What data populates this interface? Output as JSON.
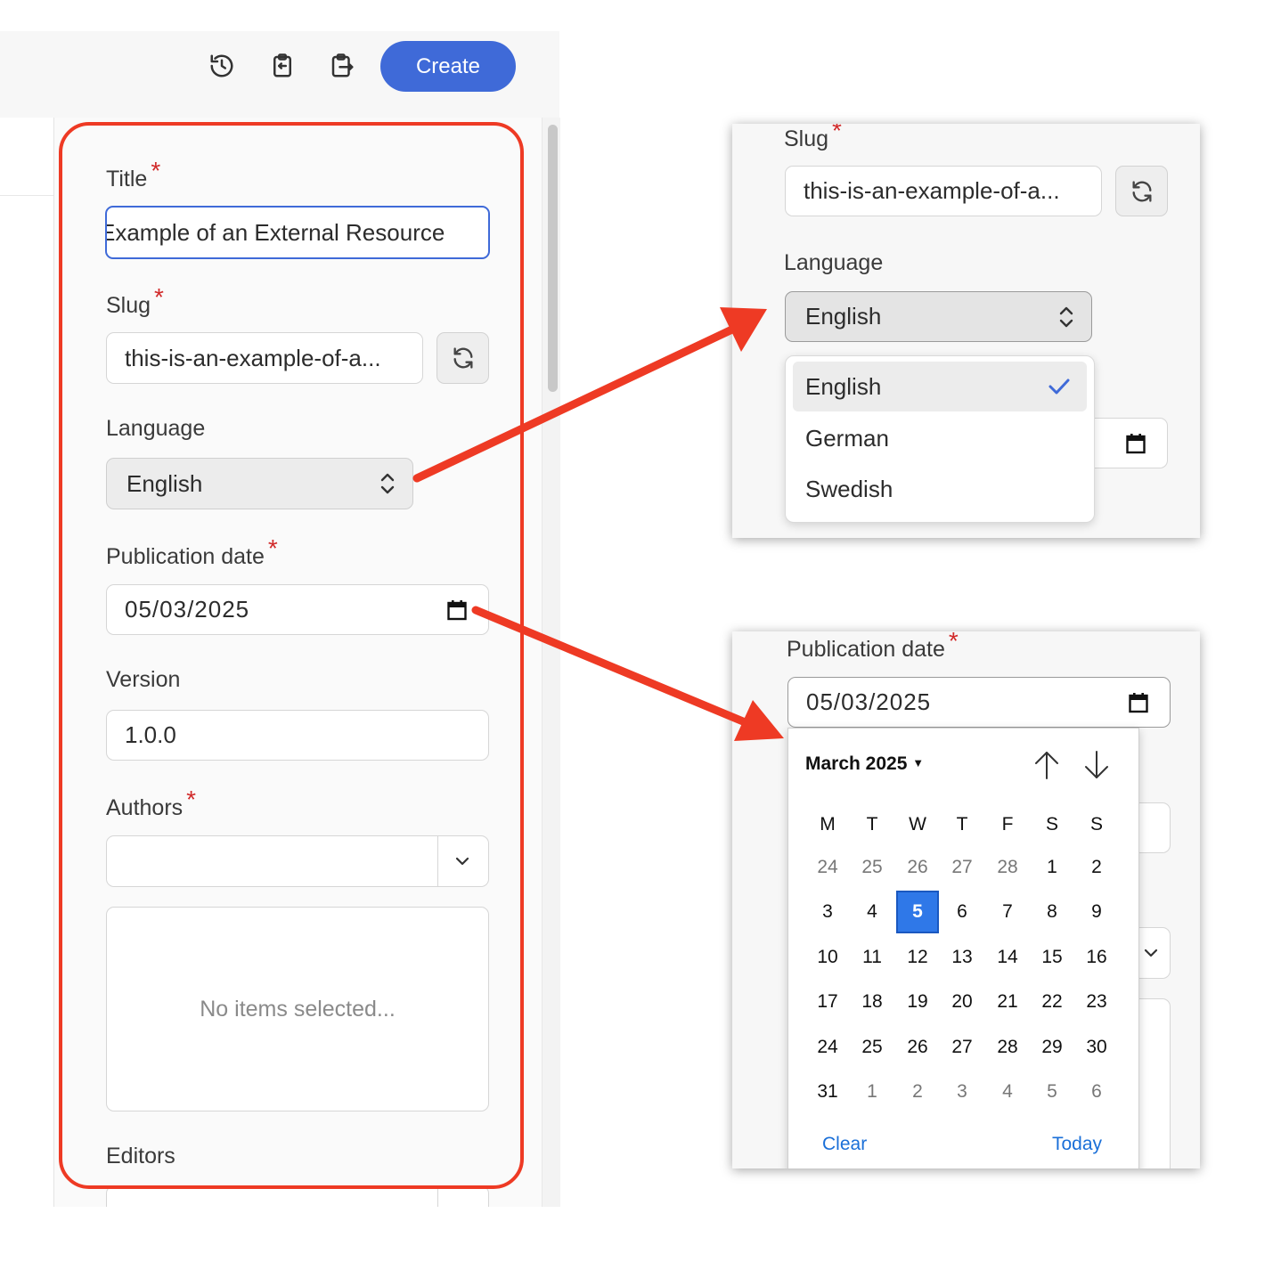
{
  "toolbar": {
    "create_label": "Create",
    "icons": [
      "history-icon",
      "clipboard-import-icon",
      "clipboard-export-icon"
    ]
  },
  "form": {
    "title_label": "Title",
    "title_value": "Example of an External Resource",
    "slug_label": "Slug",
    "slug_value": "this-is-an-example-of-a...",
    "language_label": "Language",
    "language_value": "English",
    "publication_date_label": "Publication date",
    "publication_date_value": "05/03/2025",
    "version_label": "Version",
    "version_value": "1.0.0",
    "authors_label": "Authors",
    "authors_empty": "No items selected...",
    "editors_label": "Editors",
    "required_mark": "*"
  },
  "language_popout": {
    "slug_label": "Slug",
    "slug_value": "this-is-an-example-of-a...",
    "language_label": "Language",
    "language_value": "English",
    "options": [
      "English",
      "German",
      "Swedish"
    ],
    "selected": "English"
  },
  "date_popout": {
    "label": "Publication date",
    "value": "05/03/2025",
    "month_label": "March 2025",
    "weekdays": [
      "M",
      "T",
      "W",
      "T",
      "F",
      "S",
      "S"
    ],
    "weeks": [
      [
        "24",
        "25",
        "26",
        "27",
        "28",
        "1",
        "2"
      ],
      [
        "3",
        "4",
        "5",
        "6",
        "7",
        "8",
        "9"
      ],
      [
        "10",
        "11",
        "12",
        "13",
        "14",
        "15",
        "16"
      ],
      [
        "17",
        "18",
        "19",
        "20",
        "21",
        "22",
        "23"
      ],
      [
        "24",
        "25",
        "26",
        "27",
        "28",
        "29",
        "30"
      ],
      [
        "31",
        "1",
        "2",
        "3",
        "4",
        "5",
        "6"
      ]
    ],
    "selected_day": "5",
    "clear_label": "Clear",
    "today_label": "Today"
  },
  "colors": {
    "accent": "#3f6ad8",
    "required": "#d12a2a",
    "annotation_arrow": "#ee3a24",
    "calendar_selected": "#2f78e8"
  }
}
